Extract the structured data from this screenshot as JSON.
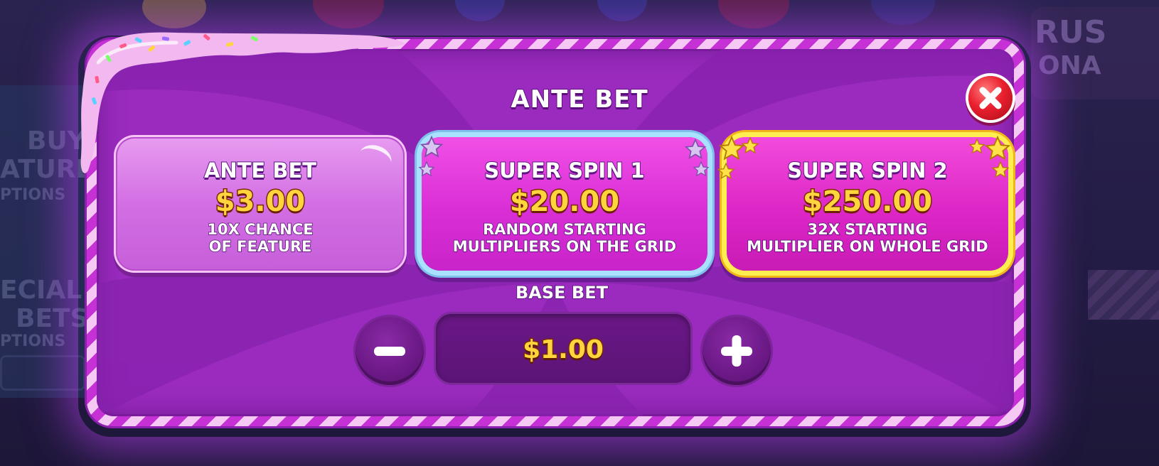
{
  "dialog": {
    "title": "ANTE BET",
    "close_icon": "close-x-icon"
  },
  "options": [
    {
      "title": "ANTE BET",
      "price": "$3.00",
      "description": "10X CHANCE\nOF FEATURE"
    },
    {
      "title": "SUPER SPIN 1",
      "price": "$20.00",
      "description": "RANDOM STARTING\nMULTIPLIERS ON THE GRID"
    },
    {
      "title": "SUPER SPIN 2",
      "price": "$250.00",
      "description": "32X STARTING\nMULTIPLIER ON WHOLE GRID"
    }
  ],
  "base_bet": {
    "label": "BASE BET",
    "value": "$1.00",
    "minus_icon": "minus-icon",
    "plus_icon": "plus-icon"
  },
  "background": {
    "left_panel_1": [
      "BUY",
      "ATURE",
      "PTIONS"
    ],
    "left_panel_2": [
      "ECIAL",
      "BETS",
      "PTIONS"
    ],
    "right_logo": [
      "RUS",
      "ONA"
    ]
  },
  "colors": {
    "accent_gold": "#ffd43c",
    "dialog_purple": "#9a2bbe",
    "super_spin_1_border": "#a9e2ff",
    "super_spin_2_border": "#ffee4f",
    "close_red": "#ea1f2e"
  }
}
